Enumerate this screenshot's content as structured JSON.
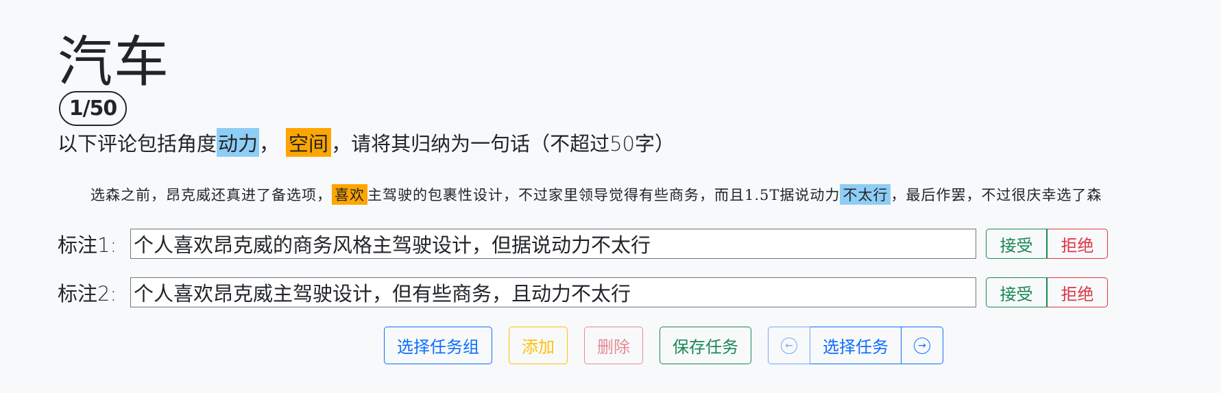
{
  "title": "汽车",
  "counter": "1/50",
  "prompt": {
    "prefix": "以下评论包括角度",
    "aspect1": "动力",
    "sep": "，",
    "aspect2": "空间",
    "suffix": "，请将其归纳为一句话（不超过50字）"
  },
  "review": {
    "part1": "选森之前，昂克威还真进了备选项，",
    "hl1": "喜欢",
    "part2": "主驾驶的包裹性设计，不过家里领导觉得有些商务，而且1.5T据说动力",
    "hl2": "不太行",
    "part3": "，最后作罢，不过很庆幸选了森"
  },
  "annotations": [
    {
      "label": "标注1:",
      "value": "个人喜欢昂克威的商务风格主驾驶设计，但据说动力不太行",
      "accept": "接受",
      "reject": "拒绝"
    },
    {
      "label": "标注2:",
      "value": "个人喜欢昂克威主驾驶设计，但有些商务，且动力不太行",
      "accept": "接受",
      "reject": "拒绝"
    }
  ],
  "toolbar": {
    "select_group": "选择任务组",
    "add": "添加",
    "delete": "删除",
    "save": "保存任务",
    "prev_icon": "arrow-left-circle-icon",
    "select_task": "选择任务",
    "next_icon": "arrow-right-circle-icon"
  },
  "colors": {
    "highlight_blue": "#8ecdf5",
    "highlight_orange": "#ffa500",
    "primary": "#0d6efd",
    "success": "#198754",
    "danger": "#dc3545",
    "warning": "#ffc107"
  }
}
